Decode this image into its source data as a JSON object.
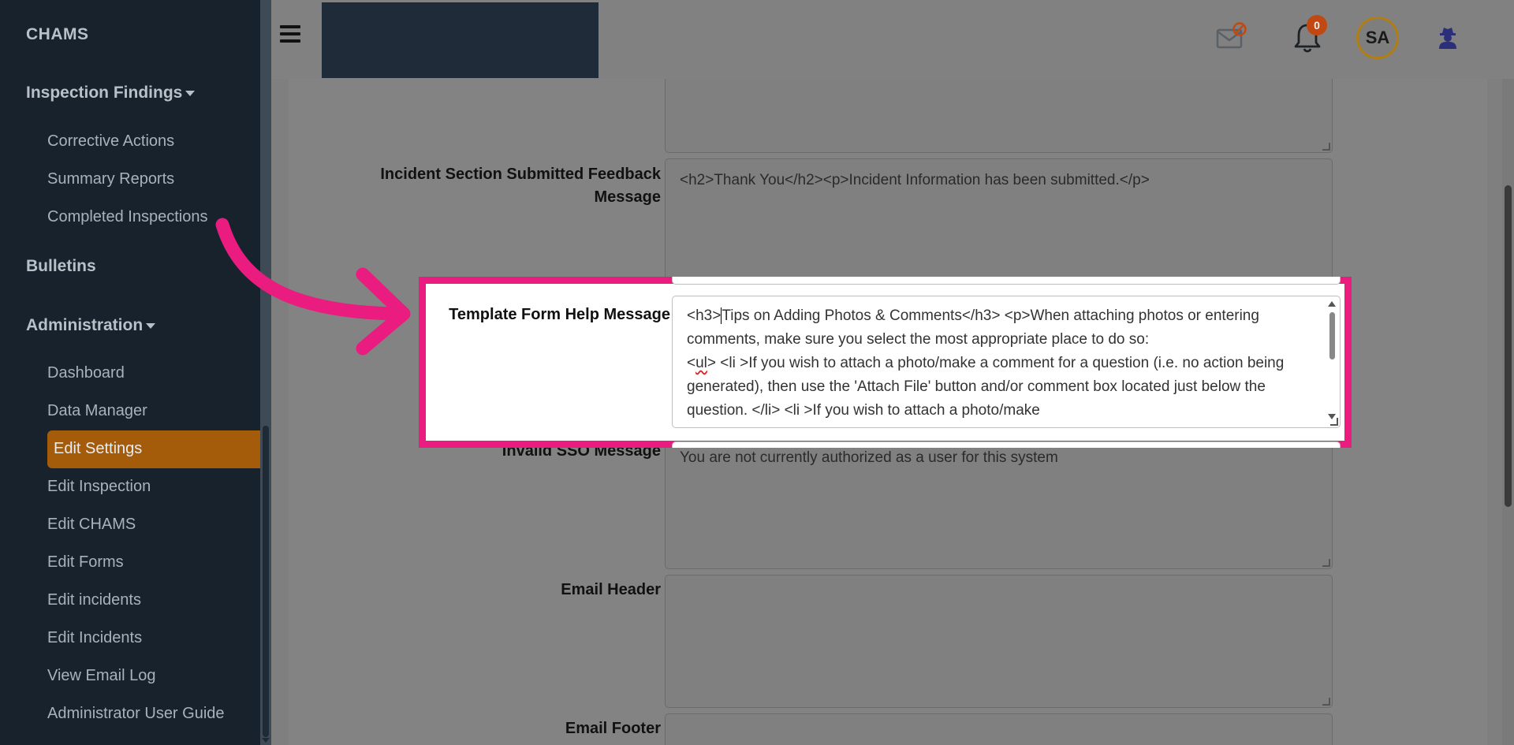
{
  "sidebar": {
    "brand": "CHAMS",
    "sections": {
      "inspection_findings": "Inspection Findings",
      "bulletins": "Bulletins",
      "administration": "Administration"
    },
    "inspection_items": [
      "Corrective Actions",
      "Summary Reports",
      "Completed Inspections"
    ],
    "admin_items": [
      "Dashboard",
      "Data Manager",
      "Edit Settings",
      "Edit Inspection",
      "Edit CHAMS",
      "Edit Forms",
      "Edit incidents",
      "Edit Incidents",
      "View Email Log",
      "Administrator User Guide"
    ],
    "active_item": "Edit Settings"
  },
  "header": {
    "notification_count": "0",
    "avatar_initials": "SA"
  },
  "form": {
    "incident_label": "Incident Section Submitted Feedback Message",
    "incident_value": "<h2>Thank You</h2><p>Incident Information has been submitted.</p>",
    "template_help_label": "Template Form Help Message",
    "template_help_line1_a": "<h3>",
    "template_help_line1_b": "Tips on Adding Photos & Comments</h3>            <p>When attaching photos or entering comments, make sure you select the most appropriate place to do so:",
    "template_help_line2_a": "<",
    "template_help_line2_ul": "ul",
    "template_help_line2_b": ">                <li >If you wish to attach a photo/make a comment for a question (i.e. no action being generated), then use the 'Attach File' button and/or comment box located just below the question.                </li>                <li >If you wish to attach a photo/make",
    "invalid_sso_label": "Invalid SSO Message",
    "invalid_sso_value": "You are not currently authorized as a user for this system",
    "email_header_label": "Email Header",
    "email_header_value": "",
    "email_footer_label": "Email Footer",
    "email_footer_value": ""
  },
  "colors": {
    "sidebar_bg": "#17222c",
    "active_item": "#a45c0b",
    "highlight_border": "#ea1c80",
    "badge": "#c24812",
    "avatar_ring": "#b07e13"
  }
}
